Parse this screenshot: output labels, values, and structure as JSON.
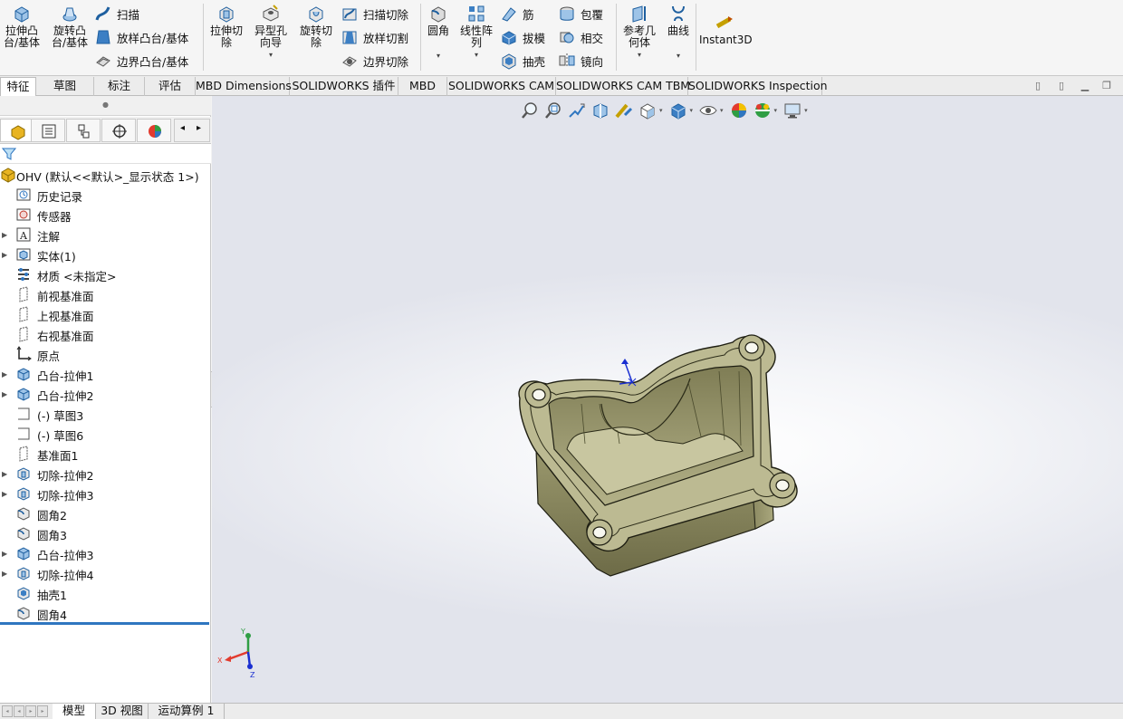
{
  "ribbon": {
    "extrude_boss": "拉伸凸\n台/基体",
    "revolve_boss": "旋转凸\n台/基体",
    "sweep": "扫描",
    "loft_boss": "放样凸台/基体",
    "boundary_boss": "边界凸台/基体",
    "extrude_cut": "拉伸切\n除",
    "hole_wizard": "异型孔\n向导",
    "revolve_cut": "旋转切\n除",
    "swept_cut": "扫描切除",
    "lofted_cut": "放样切割",
    "boundary_cut": "边界切除",
    "fillet": "圆角",
    "linear_pattern": "线性阵\n列",
    "rib": "筋",
    "draft": "拔模",
    "shell": "抽壳",
    "wrap": "包覆",
    "intersect": "相交",
    "mirror": "镜向",
    "ref_geometry": "参考几\n何体",
    "curves": "曲线",
    "instant3d": "Instant3D"
  },
  "tabs": [
    {
      "label": "特征",
      "active": true
    },
    {
      "label": "草图"
    },
    {
      "label": "标注"
    },
    {
      "label": "评估"
    },
    {
      "label": "MBD Dimensions"
    },
    {
      "label": "SOLIDWORKS 插件"
    },
    {
      "label": "MBD"
    },
    {
      "label": "SOLIDWORKS CAM"
    },
    {
      "label": "SOLIDWORKS CAM TBM"
    },
    {
      "label": "SOLIDWORKS Inspection"
    }
  ],
  "tree": {
    "root": "OHV  (默认<<默认>_显示状态 1>)",
    "items": [
      {
        "label": "历史记录",
        "icon": "history-icon",
        "expandable": false
      },
      {
        "label": "传感器",
        "icon": "sensor-icon",
        "expandable": false
      },
      {
        "label": "注解",
        "icon": "annotation-icon",
        "expandable": true
      },
      {
        "label": "实体(1)",
        "icon": "solid-bodies-icon",
        "expandable": true
      },
      {
        "label": "材质 <未指定>",
        "icon": "material-icon",
        "expandable": false
      },
      {
        "label": "前视基准面",
        "icon": "plane-icon",
        "expandable": false
      },
      {
        "label": "上视基准面",
        "icon": "plane-icon",
        "expandable": false
      },
      {
        "label": "右视基准面",
        "icon": "plane-icon",
        "expandable": false
      },
      {
        "label": "原点",
        "icon": "origin-icon",
        "expandable": false
      },
      {
        "label": "凸台-拉伸1",
        "icon": "boss-extrude-icon",
        "expandable": true
      },
      {
        "label": "凸台-拉伸2",
        "icon": "boss-extrude-icon",
        "expandable": true
      },
      {
        "label": "(-) 草图3",
        "icon": "sketch-icon",
        "expandable": false
      },
      {
        "label": "(-) 草图6",
        "icon": "sketch-icon",
        "expandable": false
      },
      {
        "label": "基准面1",
        "icon": "plane-icon",
        "expandable": false
      },
      {
        "label": "切除-拉伸2",
        "icon": "cut-extrude-icon",
        "expandable": true
      },
      {
        "label": "切除-拉伸3",
        "icon": "cut-extrude-icon",
        "expandable": true
      },
      {
        "label": "圆角2",
        "icon": "fillet-icon",
        "expandable": false
      },
      {
        "label": "圆角3",
        "icon": "fillet-icon",
        "expandable": false
      },
      {
        "label": "凸台-拉伸3",
        "icon": "boss-extrude-icon",
        "expandable": true
      },
      {
        "label": "切除-拉伸4",
        "icon": "cut-extrude-icon",
        "expandable": true
      },
      {
        "label": "抽壳1",
        "icon": "shell-icon",
        "expandable": false
      },
      {
        "label": "圆角4",
        "icon": "fillet-icon",
        "expandable": false
      }
    ]
  },
  "triad": {
    "x": "X",
    "y": "Y",
    "z": "Z"
  },
  "bottom_tabs": [
    {
      "label": "模型",
      "active": true
    },
    {
      "label": "3D 视图"
    },
    {
      "label": "运动算例 1"
    }
  ],
  "colors": {
    "part_face": "#b9b78f",
    "part_side": "#8c8a62",
    "part_edge": "#1e1e12",
    "accent_blue": "#2f76c0",
    "feature_icon": "#2a6fb3"
  }
}
